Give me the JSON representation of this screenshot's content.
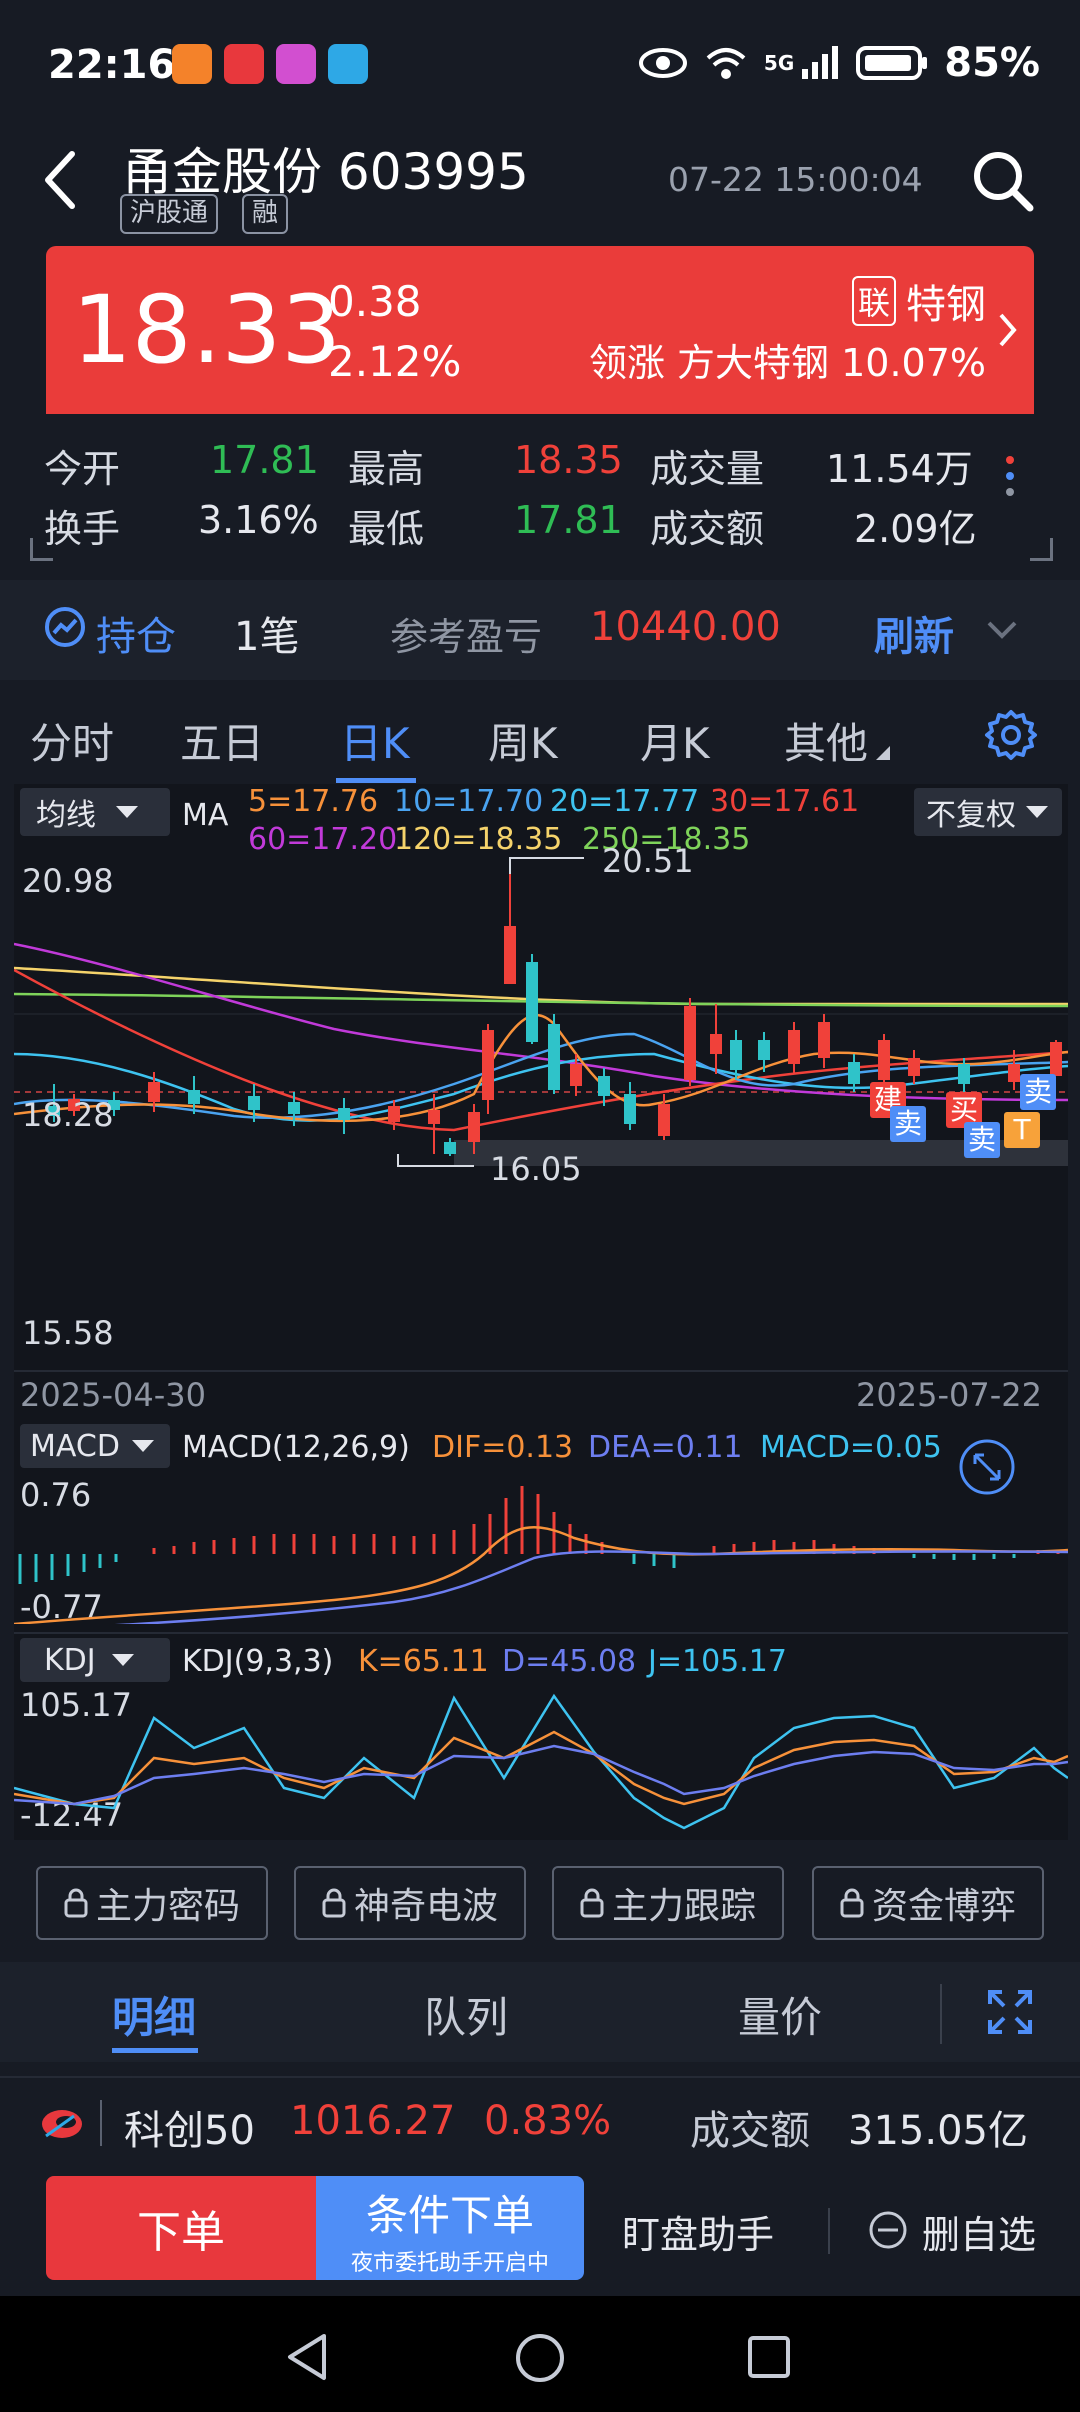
{
  "status_bar": {
    "time": "22:16",
    "battery": "85%",
    "network": "5G"
  },
  "header": {
    "stock_name": "甬金股份 603995",
    "tag_hkconnect": "沪股通",
    "tag_margin": "融",
    "datetime": "07-22 15:00:04"
  },
  "quote": {
    "price": "18.33",
    "change": "0.38",
    "change_pct": "2.12%",
    "sector_badge": "联",
    "sector_name": "特钢",
    "leader_text": "领涨 方大特钢 10.07%"
  },
  "stats": {
    "open_label": "今开",
    "open": "17.81",
    "high_label": "最高",
    "high": "18.35",
    "volume_label": "成交量",
    "volume": "11.54万",
    "turnover_label": "换手",
    "turnover": "3.16%",
    "low_label": "最低",
    "low": "17.81",
    "amount_label": "成交额",
    "amount": "2.09亿"
  },
  "position": {
    "label": "持仓",
    "count": "1笔",
    "pnl_label": "参考盈亏",
    "pnl": "10440.00",
    "refresh": "刷新"
  },
  "period_tabs": [
    "分时",
    "五日",
    "日K",
    "周K",
    "月K",
    "其他"
  ],
  "active_tab": "日K",
  "kline": {
    "indicator": "均线",
    "adjust": "不复权",
    "ma_label": "MA",
    "ma_values": [
      {
        "text": "5=17.76",
        "color": "#f7913a"
      },
      {
        "text": "10=17.70",
        "color": "#4aa3f0"
      },
      {
        "text": "20=17.77",
        "color": "#3ec3f0"
      },
      {
        "text": "30=17.61",
        "color": "#f0413a"
      },
      {
        "text": "60=17.20",
        "color": "#c13ad9"
      },
      {
        "text": "120=18.35",
        "color": "#f5d36b"
      },
      {
        "text": "250=18.35",
        "color": "#7fd35a"
      }
    ],
    "y_max": "20.98",
    "y_mid": "18.28",
    "y_min": "15.58",
    "peak_label": "20.51",
    "trough_label": "16.05",
    "date_start": "2025-04-30",
    "date_end": "2025-07-22",
    "markers": [
      {
        "text": "建",
        "color": "#f0413a"
      },
      {
        "text": "卖",
        "color": "#4f8ef7"
      },
      {
        "text": "买",
        "color": "#f0413a"
      },
      {
        "text": "卖",
        "color": "#4f8ef7"
      },
      {
        "text": "T",
        "color": "#f7a23a"
      },
      {
        "text": "卖",
        "color": "#4f8ef7"
      }
    ]
  },
  "macd": {
    "indicator": "MACD",
    "params": "MACD(12,26,9)",
    "dif": "DIF=0.13",
    "dea": "DEA=0.11",
    "macd": "MACD=0.05",
    "y_max": "0.76",
    "y_min": "-0.77"
  },
  "kdj": {
    "indicator": "KDJ",
    "params": "KDJ(9,3,3)",
    "k": "K=65.11",
    "d": "D=45.08",
    "j": "J=105.17",
    "y_max": "105.17",
    "y_min": "-12.47"
  },
  "feature_buttons": [
    "主力密码",
    "神奇电波",
    "主力跟踪",
    "资金博弈"
  ],
  "detail_tabs": [
    "明细",
    "队列",
    "量价"
  ],
  "index_bar": {
    "name": "科创50",
    "value": "1016.27",
    "change_pct": "0.83%",
    "amount_label": "成交额",
    "amount": "315.05亿"
  },
  "actions": {
    "order": "下单",
    "cond_order": "条件下单",
    "cond_sub": "夜市委托助手开启中",
    "assistant": "盯盘助手",
    "remove": "删自选"
  }
}
